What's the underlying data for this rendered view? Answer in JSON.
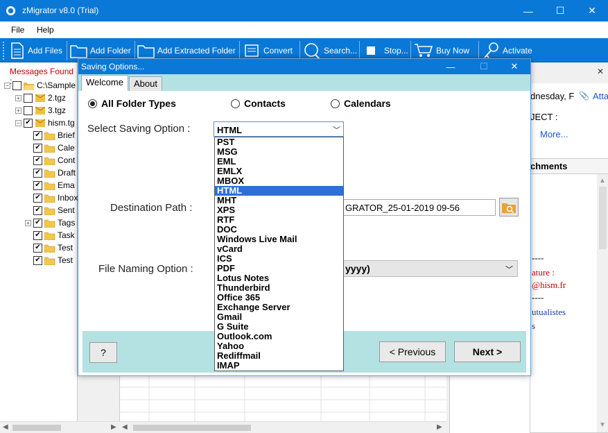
{
  "window": {
    "title": "zMigrator v8.0 (Trial)",
    "minimize": "—",
    "maximize": "☐",
    "close": "✕"
  },
  "menu": {
    "file": "File",
    "help": "Help"
  },
  "toolbar": {
    "add_files": "Add Files",
    "add_folder": "Add Folder",
    "add_extracted_folder": "Add Extracted Folder",
    "convert": "Convert",
    "search": "Search...",
    "stop": "Stop...",
    "buy_now": "Buy Now",
    "activate": "Activate"
  },
  "left": {
    "messages_found": "Messages Found :",
    "tree": {
      "root": "C:\\Sample",
      "tgz2": "2.tgz",
      "tgz3": "3.tgz",
      "hism": "hism.tg",
      "children": [
        "Brief",
        "Cale",
        "Cont",
        "Draft",
        "Ema",
        "Inbox",
        "Sent",
        "Tags",
        "Task",
        "Test",
        "Test"
      ]
    }
  },
  "right": {
    "date": "dnesday, F",
    "attach": "Atta",
    "subject": "JECT :",
    "more": "More...",
    "attachments_tab": "chments",
    "dashes1": "----",
    "signature": "ature :",
    "email": "@hism.fr",
    "dashes2": "----",
    "mutualistes": "utualistes",
    "s": "s"
  },
  "dialog": {
    "title": "Saving Options...",
    "minimize": "—",
    "maximize": "☐",
    "close": "✕",
    "tabs": {
      "welcome": "Welcome",
      "about": "About"
    },
    "radios": {
      "all_folder_types": "All Folder Types",
      "contacts": "Contacts",
      "calendars": "Calendars"
    },
    "select_saving_option_label": "Select Saving Option :",
    "selected_format": "HTML",
    "formats": [
      "PST",
      "MSG",
      "EML",
      "EMLX",
      "MBOX",
      "HTML",
      "MHT",
      "XPS",
      "RTF",
      "DOC",
      "Windows Live Mail",
      "vCard",
      "ICS",
      "PDF",
      "Lotus Notes",
      "Thunderbird",
      "Office 365",
      "Exchange Server",
      "Gmail",
      "G Suite",
      "Outlook.com",
      "Yahoo",
      "Rediffmail",
      "IMAP"
    ],
    "destination_path_label": "Destination Path :",
    "destination_path_value": "GRATOR_25-01-2019 09-56",
    "file_naming_label": "File Naming Option :",
    "file_naming_value": "yyyy)",
    "help_button": "?",
    "previous_button": "<  Previous",
    "next_button": "Next >"
  },
  "colors": {
    "titlebar": "#0a78d7",
    "dialog_band": "#b4e2e2",
    "selected_item": "#2f6fd6",
    "messages_found_red": "#c00000",
    "link_blue": "#1a56c8"
  }
}
